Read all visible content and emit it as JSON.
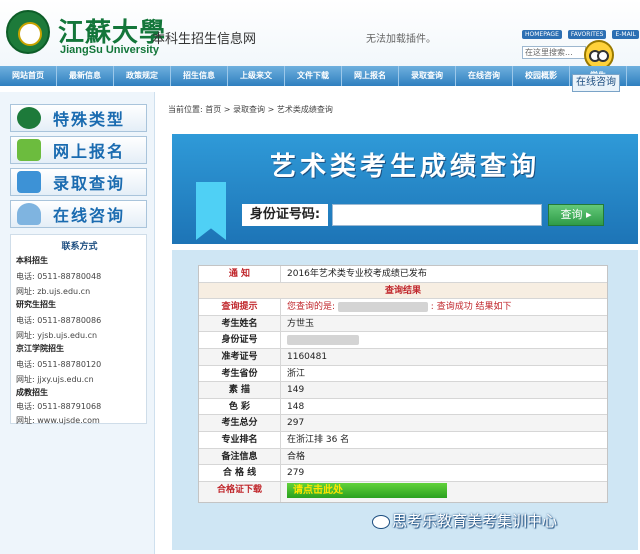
{
  "header": {
    "university_name": "江蘇大學",
    "university_en": "JiangSu University",
    "site_title": "本科生招生信息网",
    "plugin_notice": "无法加载插件。",
    "top_links": [
      "HOMEPAGE",
      "FAVORITES",
      "E-MAIL"
    ],
    "search_placeholder": "在这里搜索...",
    "consult_badge": "在线咨询"
  },
  "nav": {
    "items": [
      "网站首页",
      "最新信息",
      "政策规定",
      "招生信息",
      "上级来文",
      "文件下载",
      "网上报名",
      "录取查询",
      "在线咨询",
      "校园概影",
      "学生"
    ]
  },
  "sidebar": {
    "buttons": [
      "特殊类型",
      "网上报名",
      "录取查询",
      "在线咨询"
    ],
    "contact": {
      "title": "联系方式",
      "groups": [
        {
          "name": "本科招生",
          "phone": "电话:    0511-88780048",
          "site": "网址:    zb.ujs.edu.cn"
        },
        {
          "name": "研究生招生",
          "phone": "电话:    0511-88780086",
          "site": "网址:    yjsb.ujs.edu.cn"
        },
        {
          "name": "京江学院招生",
          "phone": "电话:    0511-88780120",
          "site": "网址:    jjxy.ujs.edu.cn"
        },
        {
          "name": "成教招生",
          "phone": "电话:    0511-88791068",
          "site": "网址:    www.ujsde.com"
        }
      ]
    }
  },
  "breadcrumb": "当前位置: 首页 > 录取查询 > 艺术类成绩查询",
  "query": {
    "title": "艺术类考生成绩查询",
    "id_label": "身份证号码:",
    "button": "查询"
  },
  "result": {
    "notice_label": "通     知",
    "notice_value": "2016年艺术类专业校考成绩已发布",
    "section_title": "查询结果",
    "hint_label": "查询提示",
    "hint_prefix": "您查询的是:",
    "hint_suffix": ": 查询成功 结果如下",
    "rows": [
      {
        "label": "考生姓名",
        "value": "方世玉"
      },
      {
        "label": "身份证号",
        "value": ""
      },
      {
        "label": "准考证号",
        "value": "1160481"
      },
      {
        "label": "考生省份",
        "value": "浙江"
      },
      {
        "label": "素     描",
        "value": "149"
      },
      {
        "label": "色     彩",
        "value": "148"
      },
      {
        "label": "考生总分",
        "value": "297"
      },
      {
        "label": "专业排名",
        "value": "在浙江排 36 名"
      },
      {
        "label": "备注信息",
        "value": "合格"
      },
      {
        "label": "合 格 线",
        "value": "279"
      }
    ],
    "cert_label": "合格证下载",
    "cert_button": "请点击此处"
  },
  "watermark": "思考乐教育美考集训中心",
  "colors": {
    "accent_blue": "#2f7fbf",
    "brand_green": "#13763a",
    "alert_red": "#c0262b"
  }
}
